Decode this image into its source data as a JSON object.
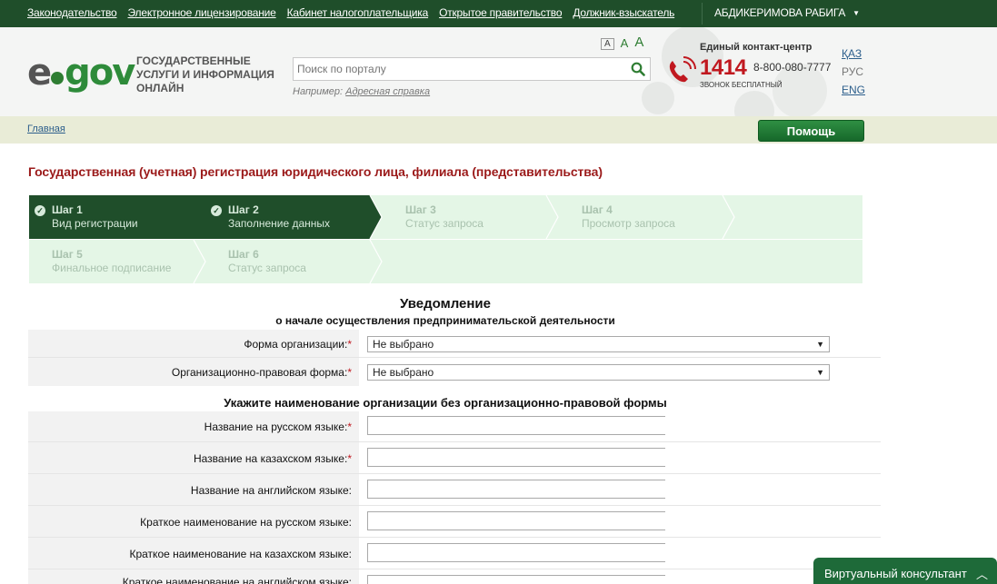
{
  "topbar": {
    "links": [
      "Законодательство",
      "Электронное лицензирование",
      "Кабинет налогоплательщика",
      "Открытое правительство",
      "Должник-взыскатель"
    ],
    "user": "АБДИКЕРИМОВА РАБИГА"
  },
  "header": {
    "logo_e": "e",
    "logo_gov": "gov",
    "tagline": "ГОСУДАРСТВЕННЫЕ УСЛУГИ И ИНФОРМАЦИЯ ОНЛАЙН",
    "search_placeholder": "Поиск по порталу",
    "example_prefix": "Например:",
    "example_link": "Адресная справка",
    "font_sizes": [
      "A",
      "A",
      "A"
    ],
    "contact_title": "Единый контакт-центр",
    "phone_short": "1414",
    "phone_long": "8-800-080-7777",
    "phone_free": "ЗВОНОК БЕСПЛАТНЫЙ",
    "langs": [
      "ҚАЗ",
      "РУС",
      "ENG"
    ],
    "active_lang_index": 1
  },
  "breadcrumb": {
    "home": "Главная"
  },
  "help_button": "Помощь",
  "page_title": "Государственная (учетная) регистрация юридического лица, филиала (представительства)",
  "steps": [
    {
      "num": "Шаг 1",
      "label": "Вид регистрации",
      "state": "done"
    },
    {
      "num": "Шаг 2",
      "label": "Заполнение данных",
      "state": "done"
    },
    {
      "num": "Шаг 3",
      "label": "Статус запроса",
      "state": "todo"
    },
    {
      "num": "Шаг 4",
      "label": "Просмотр запроса",
      "state": "todo"
    },
    {
      "num": "Шаг 5",
      "label": "Финальное подписание",
      "state": "todo"
    },
    {
      "num": "Шаг 6",
      "label": "Статус запроса",
      "state": "todo"
    }
  ],
  "form": {
    "heading": "Уведомление",
    "subheading": "о начале осуществления предпринимательской деятельности",
    "selects": [
      {
        "label": "Форма организации:",
        "value": "Не выбрано"
      },
      {
        "label": "Организационно-правовая форма:",
        "value": "Не выбрано"
      }
    ],
    "name_section": "Укажите наименование организации без организационно-правовой формы",
    "text_fields": [
      {
        "label": "Название на русском языке:",
        "required": true
      },
      {
        "label": "Название на казахском языке:",
        "required": true
      },
      {
        "label": "Название на английском языке:",
        "required": false
      },
      {
        "label": "Краткое наименование на русском языке:",
        "required": false
      },
      {
        "label": "Краткое наименование на казахском языке:",
        "required": false
      },
      {
        "label": "Краткое наименование на английском языке:",
        "required": false
      }
    ],
    "required_mark": "*"
  },
  "virtual_consultant": "Виртуальный консультант",
  "colors": {
    "topbar": "#1f4e2a",
    "brand_green": "#2e8b3a",
    "title_red": "#9b1a1a",
    "step_done": "#1f4e2a",
    "step_todo": "#e4f6e6"
  }
}
